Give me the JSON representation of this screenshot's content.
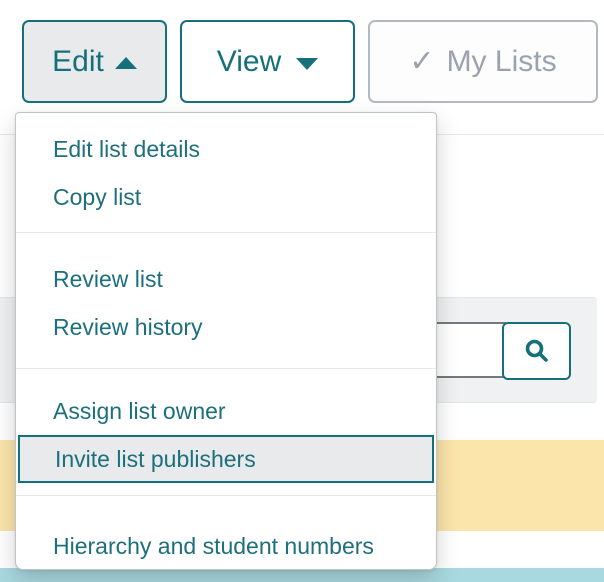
{
  "toolbar": {
    "edit": {
      "label": "Edit"
    },
    "view": {
      "label": "View"
    },
    "my_lists": {
      "label": "My Lists"
    }
  },
  "menu": {
    "groups": [
      [
        "Edit list details",
        "Copy list"
      ],
      [
        "Review list",
        "Review history"
      ],
      [
        "Assign list owner",
        "Invite list publishers"
      ],
      [
        "Hierarchy and student numbers"
      ]
    ],
    "highlighted_item": "Invite list publishers"
  },
  "search": {
    "value": "",
    "placeholder": ""
  },
  "icons": {
    "check": "✓"
  },
  "colors": {
    "accent_teal": "#16707c",
    "menu_link": "#1d6f7c",
    "disabled_gray": "#9aa2ad",
    "panel_gray": "#f0f1f2",
    "banner_yellow": "#fbe5ab",
    "band_teal": "#a9d9e0",
    "highlight_bg": "#e9eaec"
  }
}
